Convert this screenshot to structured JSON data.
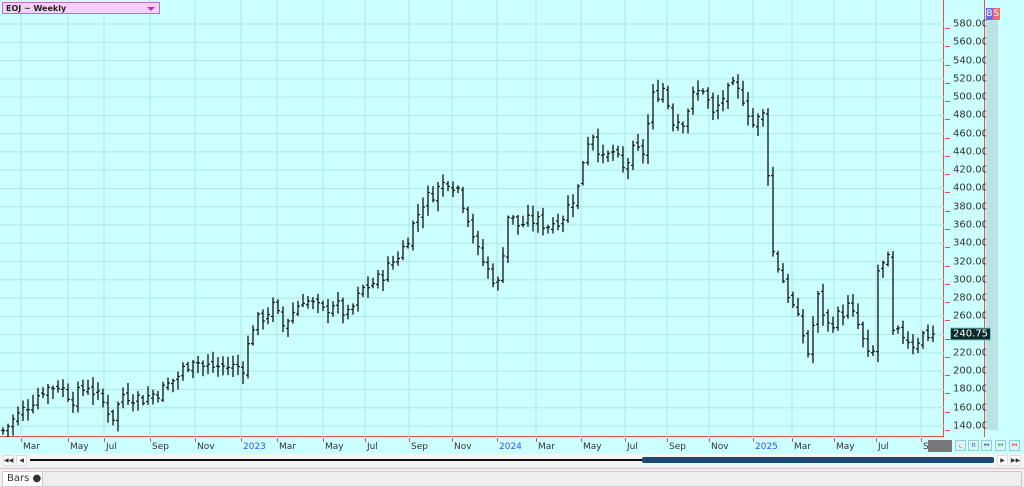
{
  "title": "EOJ ~ Weekly",
  "buttons": {
    "buy": "B",
    "sell": "S"
  },
  "tab": {
    "label": "Bars",
    "icon": "binoculars-icon"
  },
  "colors": {
    "background": "#ccffff",
    "axis": "#e05050",
    "bar": "#111111",
    "grid": "#aee6e6"
  },
  "chart_data": {
    "type": "ohlc",
    "symbol": "EOJ",
    "interval": "Weekly",
    "ylim": [
      130,
      590
    ],
    "y_ticks": [
      "140.00",
      "160.00",
      "180.00",
      "200.00",
      "220.00",
      "240.00",
      "260.00",
      "280.00",
      "300.00",
      "320.00",
      "340.00",
      "360.00",
      "380.00",
      "400.00",
      "420.00",
      "440.00",
      "460.00",
      "480.00",
      "500.00",
      "520.00",
      "540.00",
      "560.00",
      "580.00"
    ],
    "last_price": "240.75",
    "x_labels": [
      {
        "t": "Mar",
        "w": 3.6
      },
      {
        "t": "May",
        "w": 13
      },
      {
        "t": "Jul",
        "w": 20.2
      },
      {
        "t": "Sep",
        "w": 29.4
      },
      {
        "t": "Nov",
        "w": 38.4
      },
      {
        "t": "2023",
        "w": 47.6,
        "year": true
      },
      {
        "t": "Mar",
        "w": 54.8
      },
      {
        "t": "May",
        "w": 64
      },
      {
        "t": "Jul",
        "w": 72.4
      },
      {
        "t": "Sep",
        "w": 81.2
      },
      {
        "t": "Nov",
        "w": 89.8
      },
      {
        "t": "2024",
        "w": 98.8,
        "year": true
      },
      {
        "t": "Mar",
        "w": 106.6
      },
      {
        "t": "May",
        "w": 115.6
      },
      {
        "t": "Jul",
        "w": 124.4
      },
      {
        "t": "Sep",
        "w": 132.8
      },
      {
        "t": "Nov",
        "w": 141.2
      },
      {
        "t": "2025",
        "w": 150,
        "year": true
      },
      {
        "t": "Mar",
        "w": 157.8
      },
      {
        "t": "May",
        "w": 166.2
      },
      {
        "t": "Jul",
        "w": 174.6
      },
      {
        "t": "Sep",
        "w": 183.6
      }
    ],
    "weeks": 187,
    "close_keypoints": [
      [
        0,
        135
      ],
      [
        8,
        180
      ],
      [
        11,
        185
      ],
      [
        14,
        170
      ],
      [
        17,
        185
      ],
      [
        20,
        165
      ],
      [
        22,
        150
      ],
      [
        24,
        175
      ],
      [
        28,
        170
      ],
      [
        32,
        180
      ],
      [
        35,
        195
      ],
      [
        38,
        215
      ],
      [
        40,
        205
      ],
      [
        44,
        205
      ],
      [
        48,
        205
      ],
      [
        50,
        250
      ],
      [
        54,
        270
      ],
      [
        56,
        250
      ],
      [
        60,
        280
      ],
      [
        64,
        265
      ],
      [
        66,
        275
      ],
      [
        69,
        260
      ],
      [
        72,
        290
      ],
      [
        75,
        300
      ],
      [
        78,
        320
      ],
      [
        80,
        335
      ],
      [
        82,
        360
      ],
      [
        84,
        385
      ],
      [
        86,
        395
      ],
      [
        89,
        410
      ],
      [
        91,
        400
      ],
      [
        93,
        370
      ],
      [
        95,
        330
      ],
      [
        97,
        310
      ],
      [
        99,
        295
      ],
      [
        101,
        370
      ],
      [
        103,
        360
      ],
      [
        106,
        365
      ],
      [
        109,
        360
      ],
      [
        112,
        370
      ],
      [
        115,
        400
      ],
      [
        116.6,
        450
      ],
      [
        118,
        460
      ],
      [
        120,
        430
      ],
      [
        122,
        440
      ],
      [
        124,
        420
      ],
      [
        126,
        440
      ],
      [
        128,
        440
      ],
      [
        130,
        500
      ],
      [
        132,
        510
      ],
      [
        134,
        475
      ],
      [
        136,
        475
      ],
      [
        138,
        500
      ],
      [
        140,
        510
      ],
      [
        142,
        480
      ],
      [
        144,
        500
      ],
      [
        146,
        510
      ],
      [
        148,
        500
      ],
      [
        150,
        470
      ],
      [
        152,
        480
      ],
      [
        153,
        420
      ],
      [
        154,
        330
      ],
      [
        156,
        300
      ],
      [
        158,
        270
      ],
      [
        160,
        240
      ],
      [
        161,
        220
      ],
      [
        163,
        280
      ],
      [
        165,
        250
      ],
      [
        167,
        260
      ],
      [
        169,
        270
      ],
      [
        171,
        250
      ],
      [
        173,
        215
      ],
      [
        174,
        220
      ],
      [
        175,
        310
      ],
      [
        177,
        320
      ],
      [
        178,
        240
      ],
      [
        180,
        240
      ],
      [
        182,
        230
      ],
      [
        184,
        240
      ],
      [
        186,
        240.75
      ]
    ]
  }
}
